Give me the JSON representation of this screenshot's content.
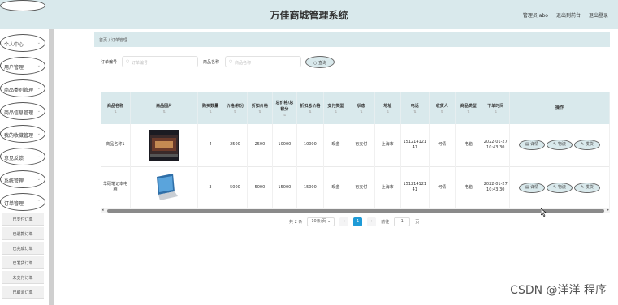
{
  "header": {
    "title": "万佳商城管理系统",
    "admin": "管理员 abo",
    "back_link": "退出到前台",
    "logout_link": "退出登录"
  },
  "sidebar": {
    "menus": [
      {
        "label": "个人中心"
      },
      {
        "label": "用户管理"
      },
      {
        "label": "商品类别管理"
      },
      {
        "label": "商品信息管理"
      },
      {
        "label": "我的收藏管理"
      },
      {
        "label": "意见反馈"
      },
      {
        "label": "系统管理"
      },
      {
        "label": "订单管理"
      }
    ],
    "submenus": [
      {
        "label": "已支付订单"
      },
      {
        "label": "已退款订单"
      },
      {
        "label": "已完成订单"
      },
      {
        "label": "已发货订单"
      },
      {
        "label": "未支付订单"
      },
      {
        "label": "已取消订单"
      }
    ]
  },
  "breadcrumb": {
    "home": "首页",
    "sep": "/",
    "current": "订单管理"
  },
  "search": {
    "order_no_label": "订单编号",
    "order_no_placeholder": "订单编号",
    "goods_name_label": "商品名称",
    "goods_name_placeholder": "商品名称",
    "query_button": "查询"
  },
  "table": {
    "columns": [
      "商品名称",
      "商品图片",
      "购买数量",
      "价格/积分",
      "折扣价格",
      "总价格/总积分",
      "折扣总价格",
      "支付类型",
      "状态",
      "地址",
      "电话",
      "收货人",
      "商品类型",
      "下单时间",
      "操作"
    ],
    "rows": [
      {
        "name": "商品名称1",
        "qty": "4",
        "price": "2500",
        "discount": "2500",
        "total": "10000",
        "discount_total": "10000",
        "pay_type": "现金",
        "status": "已支付",
        "address": "上海市",
        "phone": "15121412141",
        "receiver": "何倩",
        "goods_type": "电脑",
        "time": "2022-01-27 10:43:30",
        "image": "laptop-dark"
      },
      {
        "name": "华硕笔记本电脑",
        "qty": "3",
        "price": "5000",
        "discount": "5000",
        "total": "15000",
        "discount_total": "15000",
        "pay_type": "现金",
        "status": "已支付",
        "address": "上海市",
        "phone": "15121412141",
        "receiver": "何倩",
        "goods_type": "电脑",
        "time": "2022-01-27 10:43:30",
        "image": "laptop-silver"
      }
    ],
    "actions": {
      "detail": "详情",
      "logistics": "物流",
      "ship": "发货"
    }
  },
  "pagination": {
    "total_text": "共 2 条",
    "page_size": "10条/页",
    "prev": "‹",
    "current_page": "1",
    "next": "›",
    "goto_label": "前往",
    "goto_value": "1",
    "page_unit": "页"
  },
  "watermark": "CSDN @洋洋  程序",
  "colors": {
    "accent": "#d9e9ec",
    "pager_active": "#1e9bd7"
  }
}
